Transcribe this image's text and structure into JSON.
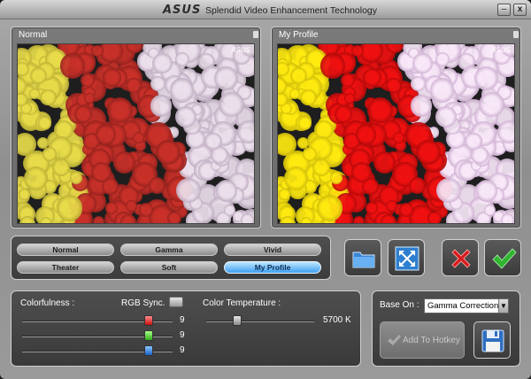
{
  "window": {
    "brand": "ASUS",
    "title": "Splendid Video Enhancement Technology",
    "minimize_label": "–",
    "close_label": "x"
  },
  "previews": {
    "left_label": "Normal",
    "right_label": "My Profile",
    "watermark": "ASUS"
  },
  "modes": [
    {
      "label": "Normal",
      "active": false
    },
    {
      "label": "Gamma",
      "active": false
    },
    {
      "label": "Vivid",
      "active": false
    },
    {
      "label": "Theater",
      "active": false
    },
    {
      "label": "Soft",
      "active": false
    },
    {
      "label": "My Profile",
      "active": true
    }
  ],
  "actions": {
    "open_icon": "folder-icon",
    "fullscreen_icon": "fullscreen-icon",
    "cancel_icon": "cross-icon",
    "ok_icon": "check-icon"
  },
  "settings": {
    "colorfulness_label": "Colorfulness :",
    "rgb_sync_label": "RGB Sync.",
    "color_temp_label": "Color Temperature :",
    "red_value": "9",
    "green_value": "9",
    "blue_value": "9",
    "red_level": 0.86,
    "green_level": 0.86,
    "blue_level": 0.86,
    "color_temp_value": "5700 K",
    "color_temp_level": 0.27
  },
  "base": {
    "label": "Base On :",
    "selected": "Gamma Correction",
    "hotkey_label": "Add To Hotkey"
  },
  "colors": {
    "accent": "#3da0f0",
    "yellow": "#f2e23a",
    "red": "#d01818",
    "pink": "#f0d8f0",
    "cancel_red": "#d81c1c",
    "ok_green": "#2fb52f"
  }
}
